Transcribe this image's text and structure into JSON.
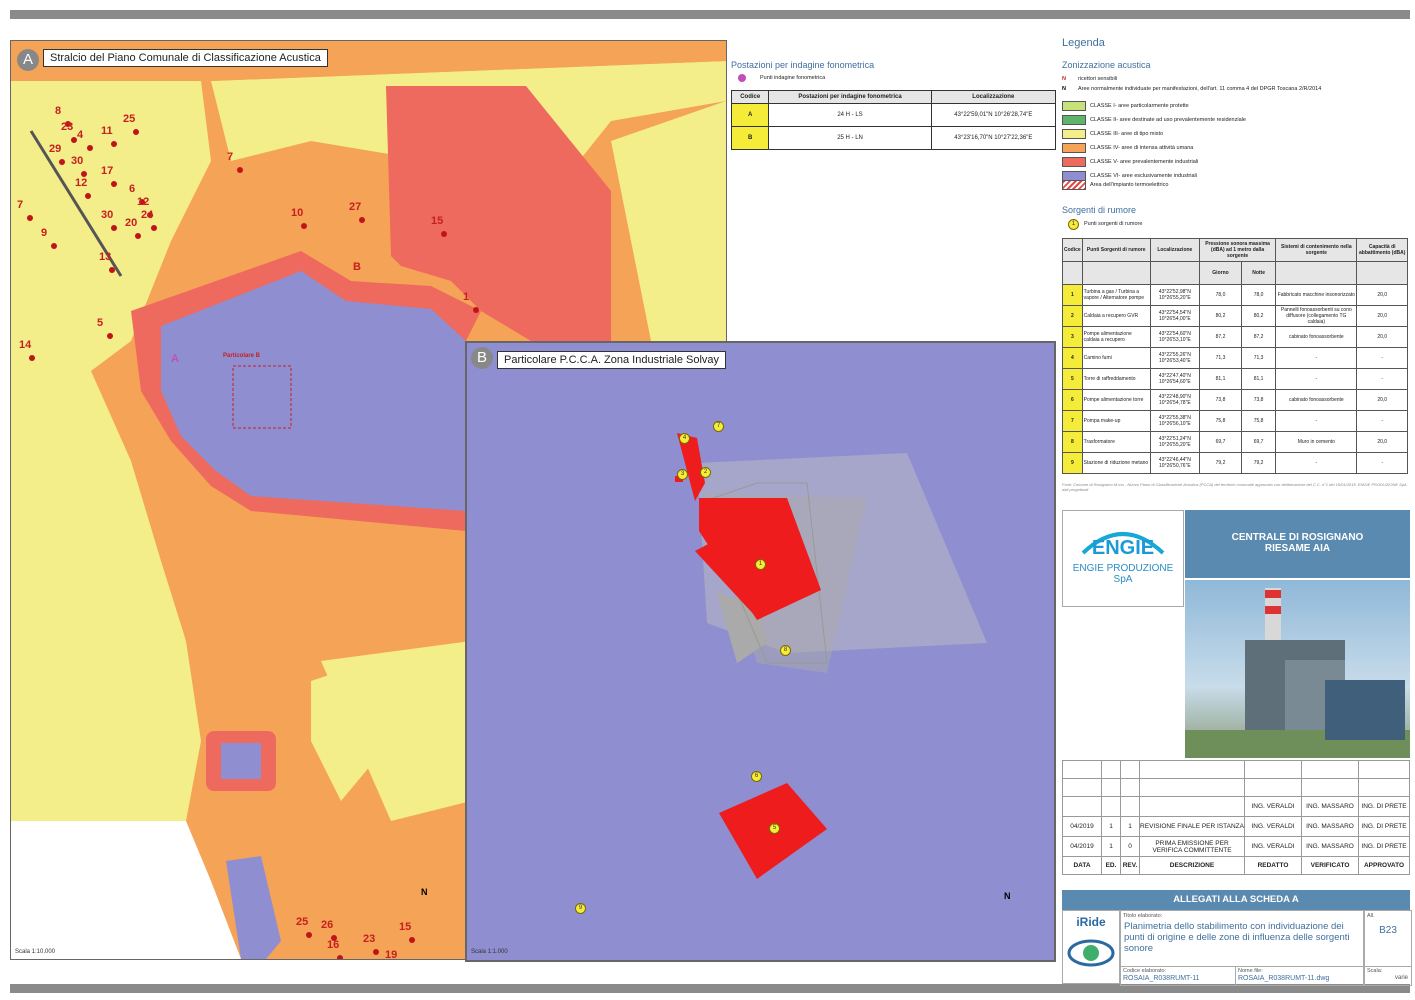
{
  "mapA": {
    "letter": "A",
    "title": "Stralcio del Piano Comunale di Classificazione Acustica",
    "scale": "Scala 1:10.000",
    "detail_label": "Particolare B",
    "point_a": "A",
    "point_b": "B",
    "receptors": [
      "8",
      "23",
      "4",
      "25",
      "11",
      "29",
      "30",
      "7",
      "12",
      "17",
      "6",
      "12",
      "24",
      "20",
      "7",
      "30",
      "10",
      "27",
      "15",
      "9",
      "13",
      "5",
      "14",
      "1",
      "25",
      "26",
      "16",
      "23",
      "15",
      "19"
    ]
  },
  "mapB": {
    "letter": "B",
    "title": "Particolare P.C.C.A. Zona Industriale Solvay",
    "scale": "Scala 1:1.000",
    "sources": [
      "1",
      "2",
      "3",
      "4",
      "5",
      "6",
      "7",
      "8",
      "9"
    ]
  },
  "north_label": "N",
  "postazioni": {
    "heading": "Postazioni per indagine fonometrica",
    "legend_item": "Punti indagine fonometrica",
    "headers": [
      "Codice",
      "Postazioni per indagine fonometrica",
      "Localizzazione"
    ],
    "rows": [
      {
        "code": "A",
        "desc": "24 H - LS",
        "loc": "43°22'59,01\"N  10°26'28,74\"E"
      },
      {
        "code": "B",
        "desc": "25 H - LN",
        "loc": "43°23'16,70\"N  10°27'22,36\"E"
      }
    ]
  },
  "legenda": {
    "title": "Legenda",
    "zon_heading": "Zonizzazione acustica",
    "n1": "ricettori sensibili",
    "n2": "Aree normalmente individuate per manifestazioni, dell'art. 11 comma 4 del DPGR Toscana 2/R/2014",
    "classes": [
      {
        "label": "CLASSE I- aree particolarmente protette",
        "color": "#c8e27a"
      },
      {
        "label": "CLASSE II- aree destinate ad uso prevalentemente residenziale",
        "color": "#5fb36a"
      },
      {
        "label": "CLASSE III- aree di tipo misto",
        "color": "#f3ee8a"
      },
      {
        "label": "CLASSE IV- aree di intensa attività umana",
        "color": "#f5a357"
      },
      {
        "label": "CLASSE V- aree prevalentemente industriali",
        "color": "#ee6a5e"
      },
      {
        "label": "CLASSE VI- aree esclusivamente industriali",
        "color": "#8f8ed0"
      }
    ],
    "hatch_label": "Area dell'impianto termoelettrico",
    "plant_label": "",
    "src_heading": "Sorgenti di rumore",
    "src_legend": "Punti sorgenti di rumore"
  },
  "sorgenti": {
    "headers": [
      "Codice",
      "Punti Sorgenti di rumore",
      "Localizzazione",
      "Pressione sonora massima (dBA) ad 1 metro dalla sorgente",
      "Sistemi di contenimento nella sorgente",
      "Capacità di abbattimento (dBA)"
    ],
    "sub": [
      "Giorno",
      "Notte"
    ],
    "rows": [
      {
        "c": "1",
        "n": "Turbina a gas / Turbina a vapore / Alternatore pompe",
        "l": "43°22'52,98\"N 10°26'55,20\"E",
        "g": "78,0",
        "t": "78,0",
        "s": "Fabbricato macchine insonorizzato",
        "a": "20,0"
      },
      {
        "c": "2",
        "n": "Caldaia a recupero GVR",
        "l": "43°22'54,54\"N 10°26'54,00\"E",
        "g": "80,2",
        "t": "80,2",
        "s": "Pannelli fonoassorbenti su cono diffusore (collegamento TG caldaia)",
        "a": "20,0"
      },
      {
        "c": "3",
        "n": "Pompe alimentazione caldaia a recupero",
        "l": "43°22'54,60\"N 10°26'53,10\"E",
        "g": "87,2",
        "t": "87,2",
        "s": "cabinato fonoassorbente",
        "a": "20,0"
      },
      {
        "c": "4",
        "n": "Camino fumi",
        "l": "43°22'55,26\"N 10°26'53,40\"E",
        "g": "71,3",
        "t": "71,3",
        "s": "-",
        "a": "-"
      },
      {
        "c": "5",
        "n": "Torre di raffreddamento",
        "l": "43°22'47,40\"N 10°26'54,60\"E",
        "g": "81,1",
        "t": "81,1",
        "s": "-",
        "a": "-"
      },
      {
        "c": "6",
        "n": "Pompe alimentazione torre",
        "l": "43°22'48,90\"N 10°26'54,78\"E",
        "g": "73,8",
        "t": "73,8",
        "s": "cabinato fonoassorbente",
        "a": "20,0"
      },
      {
        "c": "7",
        "n": "Pompa make-up",
        "l": "43°22'55,38\"N 10°26'56,10\"E",
        "g": "75,8",
        "t": "75,8",
        "s": "-",
        "a": "-"
      },
      {
        "c": "8",
        "n": "Trasformatore",
        "l": "43°22'51,24\"N 10°26'55,20\"E",
        "g": "69,7",
        "t": "69,7",
        "s": "Muro in cemento",
        "a": "20,0"
      },
      {
        "c": "9",
        "n": "Stazione di riduzione metano",
        "l": "43°22'46,44\"N 10°26'50,76\"E",
        "g": "79,2",
        "t": "79,2",
        "s": "-",
        "a": "-"
      }
    ]
  },
  "footnote": "Fonti: Comune di Rosignano M.mo - Nuovo Piano di Classificazione Acustica (PCCA) del territorio comunale approvato con deliberazione del C.C. n°1 del 15/01/2018, ENGIE PRODUZIONE SpA dati progettuali",
  "company": {
    "brand": "ENGIE",
    "sub": "ENGIE PRODUZIONE SpA"
  },
  "project": {
    "line1": "CENTRALE DI ROSIGNANO",
    "line2": "RIESAME AIA"
  },
  "revisions": {
    "blank_row": {
      "redatto": "ING. VERALDI",
      "verificato": "ING. MASSARO",
      "approvato": "ING. DI PRETE"
    },
    "rows": [
      {
        "data": "04/2019",
        "ed": "1",
        "rev": "1",
        "desc": "REVISIONE FINALE PER ISTANZA",
        "redatto": "ING. VERALDI",
        "verificato": "ING. MASSARO",
        "approvato": "ING. DI PRETE"
      },
      {
        "data": "04/2019",
        "ed": "1",
        "rev": "0",
        "desc": "PRIMA EMISSIONE PER VERIFICA COMMITTENTE",
        "redatto": "ING. VERALDI",
        "verificato": "ING. MASSARO",
        "approvato": "ING. DI PRETE"
      }
    ],
    "headers": [
      "DATA",
      "ED.",
      "REV.",
      "DESCRIZIONE",
      "REDATTO",
      "VERIFICATO",
      "APPROVATO"
    ]
  },
  "allegati": "ALLEGATI ALLA SCHEDA A",
  "iride": "iRide",
  "titolo_label": "Titolo elaborato:",
  "titolo": "Planimetria dello stabilimento con individuazione dei punti di origine e delle zone di influenza delle sorgenti sonore",
  "all_label": "All.",
  "all_value": "B23",
  "codice_label": "Codice elaborato:",
  "codice_value": "ROSAIA_R038RUMT-11",
  "nome_label": "Nome file:",
  "nome_value": "ROSAIA_R038RUMT-11.dwg",
  "scala_label": "Scala:",
  "scala_value": "varie"
}
